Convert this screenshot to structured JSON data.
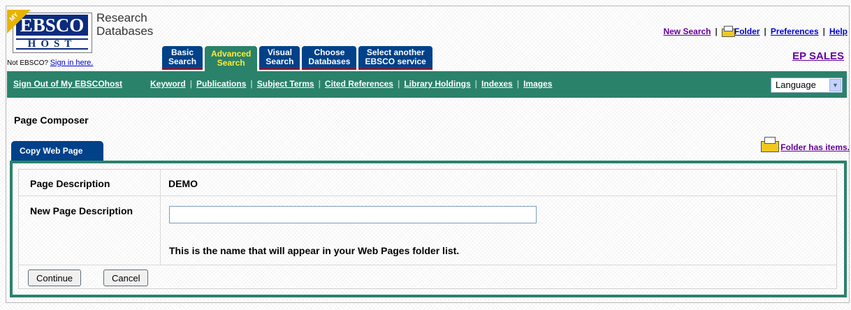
{
  "logo": {
    "badge": "MY",
    "brand": "EBSCO",
    "host": "HOST",
    "line1": "Research",
    "line2": "Databases"
  },
  "account": {
    "prompt": "Not EBSCO?",
    "sign_in": "Sign in here."
  },
  "tabs": [
    {
      "label": "Basic\nSearch",
      "active": false
    },
    {
      "label": "Advanced\nSearch",
      "active": true
    },
    {
      "label": "Visual\nSearch",
      "active": false
    },
    {
      "label": "Choose\nDatabases",
      "active": false
    },
    {
      "label": "Select another\nEBSCO service",
      "active": false
    }
  ],
  "toplinks": {
    "new_search": "New Search",
    "folder": "Folder",
    "preferences": "Preferences",
    "help": "Help",
    "separator": "|"
  },
  "profile": {
    "name": "EP SALES"
  },
  "greenbar": {
    "sign_out": "Sign Out of My EBSCOhost",
    "links": [
      "Keyword",
      "Publications",
      "Subject Terms",
      "Cited References",
      "Library Holdings",
      "Indexes",
      "Images"
    ],
    "separator": "|",
    "language": "Language"
  },
  "page": {
    "title": "Page Composer",
    "tab": "Copy Web Page",
    "folder_status": "Folder has items."
  },
  "form": {
    "desc_label": "Page Description",
    "desc_value": "DEMO",
    "new_desc_label": "New Page Description",
    "new_desc_value": "",
    "hint": "This is the name that will appear in your Web Pages folder list.",
    "continue": "Continue",
    "cancel": "Cancel"
  },
  "colors": {
    "nav_blue": "#00418a",
    "green": "#2a826a",
    "active_tab_text": "#ffea3a",
    "visited": "#660099"
  }
}
